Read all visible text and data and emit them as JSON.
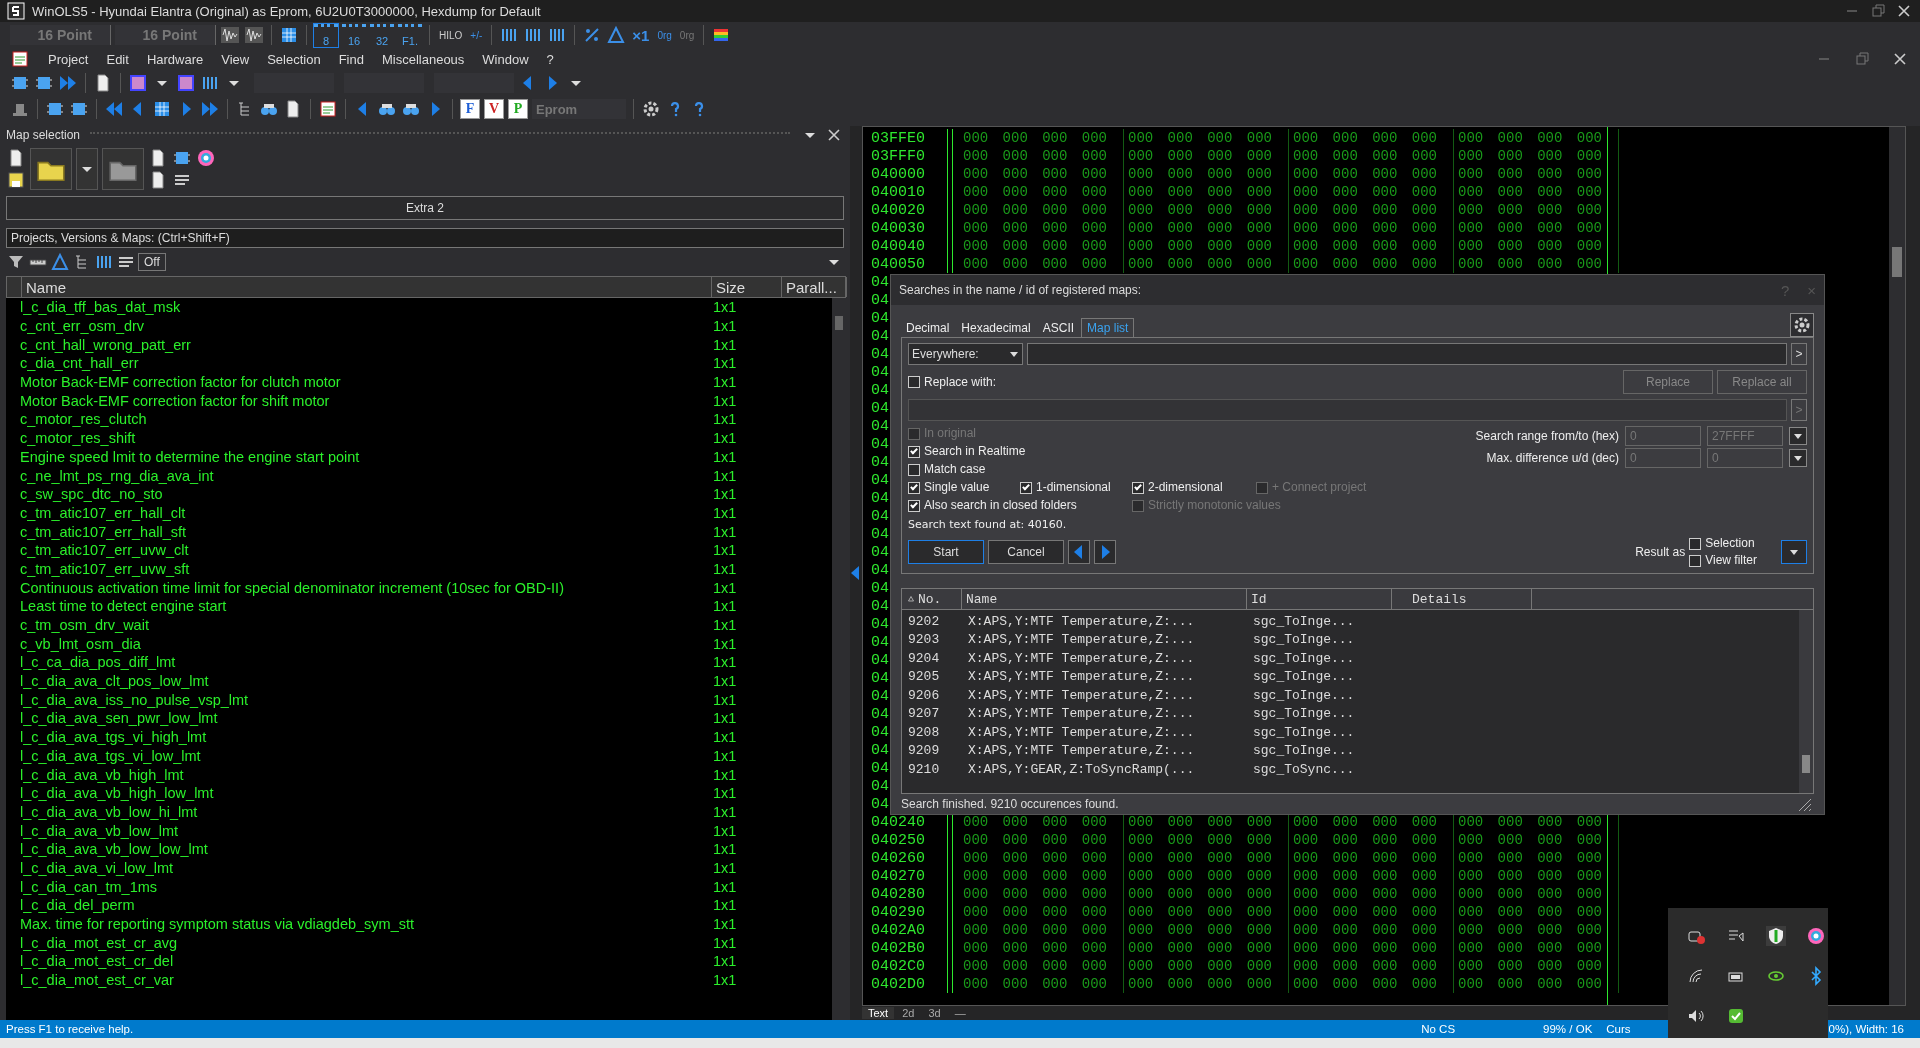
{
  "window": {
    "title": "WinOLS5 - Hyundai Elantra (Original) as Eprom, 6U2U0T3000000, Hexdump for Default"
  },
  "toolbar_top": {
    "font_fields": [
      "16 Point",
      "16 Point"
    ],
    "bit_labels": [
      "8",
      "16",
      "32",
      "F1."
    ],
    "order_label": "HILO",
    "sign_label": "+/-",
    "factor_label": "×1",
    "origin_labels": [
      "0rg",
      "0rg"
    ]
  },
  "menu": [
    "Project",
    "Edit",
    "Hardware",
    "View",
    "Selection",
    "Find",
    "Miscellaneous",
    "Window",
    "?"
  ],
  "toolbar_bottom": {
    "letter_buttons": [
      "F",
      "V",
      "P"
    ],
    "eprom_field": "Eprom"
  },
  "map_panel": {
    "title": "Map selection",
    "extra_button": "Extra 2",
    "filter": "Projects, Versions & Maps:  (Ctrl+Shift+F)",
    "off_button": "Off",
    "columns": [
      "Name",
      "Size",
      "Parall..."
    ],
    "rows": [
      {
        "name": "l_c_dia_tff_bas_dat_msk",
        "size": "1x1"
      },
      {
        "name": "c_cnt_err_osm_drv",
        "size": "1x1"
      },
      {
        "name": "c_cnt_hall_wrong_patt_err",
        "size": "1x1"
      },
      {
        "name": "c_dia_cnt_hall_err",
        "size": "1x1"
      },
      {
        "name": "Motor Back-EMF correction factor for clutch motor",
        "size": "1x1"
      },
      {
        "name": "Motor Back-EMF correction factor for shift motor",
        "size": "1x1"
      },
      {
        "name": "c_motor_res_clutch",
        "size": "1x1"
      },
      {
        "name": "c_motor_res_shift",
        "size": "1x1"
      },
      {
        "name": "Engine speed lmit to determine the engine start point",
        "size": "1x1"
      },
      {
        "name": "c_ne_lmt_ps_rng_dia_ava_int",
        "size": "1x1"
      },
      {
        "name": "c_sw_spc_dtc_no_sto",
        "size": "1x1"
      },
      {
        "name": "c_tm_atic107_err_hall_clt",
        "size": "1x1"
      },
      {
        "name": "c_tm_atic107_err_hall_sft",
        "size": "1x1"
      },
      {
        "name": "c_tm_atic107_err_uvw_clt",
        "size": "1x1"
      },
      {
        "name": "c_tm_atic107_err_uvw_sft",
        "size": "1x1"
      },
      {
        "name": "Continuous activation time limit for special denominator increment (10sec for OBD-II)",
        "size": "1x1"
      },
      {
        "name": "Least time to detect engine start",
        "size": "1x1"
      },
      {
        "name": "c_tm_osm_drv_wait",
        "size": "1x1"
      },
      {
        "name": "c_vb_lmt_osm_dia",
        "size": "1x1"
      },
      {
        "name": "l_c_ca_dia_pos_diff_lmt",
        "size": "1x1"
      },
      {
        "name": "l_c_dia_ava_clt_pos_low_lmt",
        "size": "1x1"
      },
      {
        "name": "l_c_dia_ava_iss_no_pulse_vsp_lmt",
        "size": "1x1"
      },
      {
        "name": "l_c_dia_ava_sen_pwr_low_lmt",
        "size": "1x1"
      },
      {
        "name": "l_c_dia_ava_tgs_vi_high_lmt",
        "size": "1x1"
      },
      {
        "name": "l_c_dia_ava_tgs_vi_low_lmt",
        "size": "1x1"
      },
      {
        "name": "l_c_dia_ava_vb_high_lmt",
        "size": "1x1"
      },
      {
        "name": "l_c_dia_ava_vb_high_low_lmt",
        "size": "1x1"
      },
      {
        "name": "l_c_dia_ava_vb_low_hi_lmt",
        "size": "1x1"
      },
      {
        "name": "l_c_dia_ava_vb_low_lmt",
        "size": "1x1"
      },
      {
        "name": "l_c_dia_ava_vb_low_low_lmt",
        "size": "1x1"
      },
      {
        "name": "l_c_dia_ava_vi_low_lmt",
        "size": "1x1"
      },
      {
        "name": "l_c_dia_can_tm_1ms",
        "size": "1x1"
      },
      {
        "name": "l_c_dia_del_perm",
        "size": "1x1"
      },
      {
        "name": "Max. time for reporting symptom status via vdiagdeb_sym_stt",
        "size": "1x1"
      },
      {
        "name": "l_c_dia_mot_est_cr_avg",
        "size": "1x1"
      },
      {
        "name": "l_c_dia_mot_est_cr_del",
        "size": "1x1"
      },
      {
        "name": "l_c_dia_mot_est_cr_var",
        "size": "1x1"
      }
    ]
  },
  "hexdump": {
    "rows": [
      {
        "address": "03FFE0",
        "groups": [
          "000 000 000 000",
          "000 000 000 000",
          "000 000 000 000",
          "000 000 000 000"
        ]
      },
      {
        "address": "03FFF0",
        "groups": [
          "000 000 000 000",
          "000 000 000 000",
          "000 000 000 000",
          "000 000 000 000"
        ]
      },
      {
        "address": "040000",
        "groups": [
          "000 000 000 000",
          "000 000 000 000",
          "000 000 000 000",
          "000 000 000 000"
        ]
      },
      {
        "address": "040010",
        "groups": [
          "000 000 000 000",
          "000 000 000 000",
          "000 000 000 000",
          "000 000 000 000"
        ]
      },
      {
        "address": "040020",
        "groups": [
          "000 000 000 000",
          "000 000 000 000",
          "000 000 000 000",
          "000 000 000 000"
        ]
      },
      {
        "address": "040030",
        "groups": [
          "000 000 000 000",
          "000 000 000 000",
          "000 000 000 000",
          "000 000 000 000"
        ]
      },
      {
        "address": "040040",
        "groups": [
          "000 000 000 000",
          "000 000 000 000",
          "000 000 000 000",
          "000 000 000 000"
        ]
      },
      {
        "address": "040050",
        "groups": [
          "000 000 000 000",
          "000 000 000 000",
          "000 000 000 000",
          "000 000 000 000"
        ]
      },
      {
        "address": "04"
      },
      {
        "address": "04"
      },
      {
        "address": "04"
      },
      {
        "address": "04"
      },
      {
        "address": "04"
      },
      {
        "address": "04"
      },
      {
        "address": "04"
      },
      {
        "address": "04"
      },
      {
        "address": "04"
      },
      {
        "address": "04"
      },
      {
        "address": "04"
      },
      {
        "address": "04"
      },
      {
        "address": "04"
      },
      {
        "address": "04"
      },
      {
        "address": "04"
      },
      {
        "address": "04"
      },
      {
        "address": "04"
      },
      {
        "address": "04"
      },
      {
        "address": "04"
      },
      {
        "address": "04"
      },
      {
        "address": "04"
      },
      {
        "address": "04"
      },
      {
        "address": "04"
      },
      {
        "address": "04"
      },
      {
        "address": "04"
      },
      {
        "address": "04"
      },
      {
        "address": "04"
      },
      {
        "address": "04"
      },
      {
        "address": "04"
      },
      {
        "address": "04"
      },
      {
        "address": "040240",
        "groups": [
          "000 000 000 000",
          "000 000 000 000",
          "000 000 000 000",
          "000 000 000 000"
        ]
      },
      {
        "address": "040250",
        "groups": [
          "000 000 000 000",
          "000 000 000 000",
          "000 000 000 000",
          "000 000 000 000"
        ]
      },
      {
        "address": "040260",
        "groups": [
          "000 000 000 000",
          "000 000 000 000",
          "000 000 000 000",
          "000 000 000 000"
        ]
      },
      {
        "address": "040270",
        "groups": [
          "000 000 000 000",
          "000 000 000 000",
          "000 000 000 000",
          "000 000 000 000"
        ]
      },
      {
        "address": "040280",
        "groups": [
          "000 000 000 000",
          "000 000 000 000",
          "000 000 000 000",
          "000 000 000 000"
        ]
      },
      {
        "address": "040290",
        "groups": [
          "000 000 000 000",
          "000 000 000 000",
          "000 000 000 000",
          "000 000 000 000"
        ]
      },
      {
        "address": "0402A0",
        "groups": [
          "000 000 000 000",
          "000 000 000 000",
          "000 000 000 000",
          "000 000 000 000"
        ]
      },
      {
        "address": "0402B0",
        "groups": [
          "000 000 000 000",
          "000 000 000 000",
          "000 000 000 000",
          "000 000 000 000"
        ]
      },
      {
        "address": "0402C0",
        "groups": [
          "000 000 000 000",
          "000 000 000 000",
          "000 000 000 000",
          "000 000 000 000"
        ]
      },
      {
        "address": "0402D0",
        "groups": [
          "000 000 000 000",
          "000 000 000 000",
          "000 000 000 000",
          "000 000 000 000"
        ]
      }
    ],
    "tabs": [
      {
        "label": "Text",
        "selected": true
      },
      {
        "label": "2d",
        "selected": false
      },
      {
        "label": "3d",
        "selected": false
      },
      {
        "label": "—",
        "selected": false
      }
    ]
  },
  "dialog": {
    "title": "Searches in the name / id of registered maps:",
    "help_glyph": "?",
    "close_glyph": "×",
    "tabs": [
      {
        "label": "Decimal",
        "selected": false
      },
      {
        "label": "Hexadecimal",
        "selected": false
      },
      {
        "label": "ASCII",
        "selected": false
      },
      {
        "label": "Map list",
        "selected": true
      }
    ],
    "scope": "Everywhere:",
    "go_glyph": ">",
    "replace": {
      "label": "Replace with:",
      "checked": false
    },
    "replace_buttons": [
      {
        "label": "Replace",
        "disabled": true
      },
      {
        "label": "Replace all",
        "disabled": true
      }
    ],
    "option_rows": [
      [
        {
          "label": "In original",
          "checked": false,
          "disabled": true
        }
      ],
      [
        {
          "label": "Search in Realtime",
          "checked": true,
          "disabled": false
        }
      ],
      [
        {
          "label": "Match case",
          "checked": false,
          "disabled": false
        }
      ],
      [
        {
          "label": "Single value",
          "checked": true,
          "disabled": false
        },
        {
          "label": "1-dimensional",
          "checked": true,
          "disabled": false
        },
        {
          "label": "2-dimensional",
          "checked": true,
          "disabled": false
        },
        {
          "label": "+ Connect project",
          "checked": false,
          "disabled": true
        }
      ],
      [
        {
          "label": "Also search in closed folders",
          "checked": true,
          "disabled": false
        },
        {
          "label": "Strictly monotonic values",
          "checked": false,
          "disabled": true
        }
      ]
    ],
    "ranges": [
      {
        "label": "Search range from/to (hex)",
        "from": "0",
        "to": "27FFFF"
      },
      {
        "label": "Max. difference u/d (dec)",
        "from": "0",
        "to": "0"
      }
    ],
    "found_text": "Search text found at: 40160.",
    "buttons": [
      {
        "label": "Start",
        "selected": true
      },
      {
        "label": "Cancel",
        "selected": false
      }
    ],
    "result_as": {
      "label": "Result as",
      "options": [
        {
          "label": "Selection",
          "checked": false
        },
        {
          "label": "View filter",
          "checked": false
        }
      ]
    },
    "results": {
      "columns": [
        "No.",
        "Name",
        "Id",
        "Details"
      ],
      "rows": [
        {
          "no": "9202",
          "name": "X:APS,Y:MTF Temperature,Z:...",
          "id": "sgc_ToInge..."
        },
        {
          "no": "9203",
          "name": "X:APS,Y:MTF Temperature,Z:...",
          "id": "sgc_ToInge..."
        },
        {
          "no": "9204",
          "name": "X:APS,Y:MTF Temperature,Z:...",
          "id": "sgc_ToInge..."
        },
        {
          "no": "9205",
          "name": "X:APS,Y:MTF Temperature,Z:...",
          "id": "sgc_ToInge..."
        },
        {
          "no": "9206",
          "name": "X:APS,Y:MTF Temperature,Z:...",
          "id": "sgc_ToInge..."
        },
        {
          "no": "9207",
          "name": "X:APS,Y:MTF Temperature,Z:...",
          "id": "sgc_ToInge..."
        },
        {
          "no": "9208",
          "name": "X:APS,Y:MTF Temperature,Z:...",
          "id": "sgc_ToInge..."
        },
        {
          "no": "9209",
          "name": "X:APS,Y:MTF Temperature,Z:...",
          "id": "sgc_ToInge..."
        },
        {
          "no": "9210",
          "name": "X:APS,Y:GEAR,Z:ToSyncRamp(...",
          "id": "sgc_ToSync..."
        }
      ]
    },
    "status": "Search finished. 9210 occurences found."
  },
  "status_bar": {
    "help": "Press F1 to receive help.",
    "checksum": "No CS",
    "state": "99% / OK",
    "cursor": "Curs",
    "width": "0%), Width: 16"
  }
}
